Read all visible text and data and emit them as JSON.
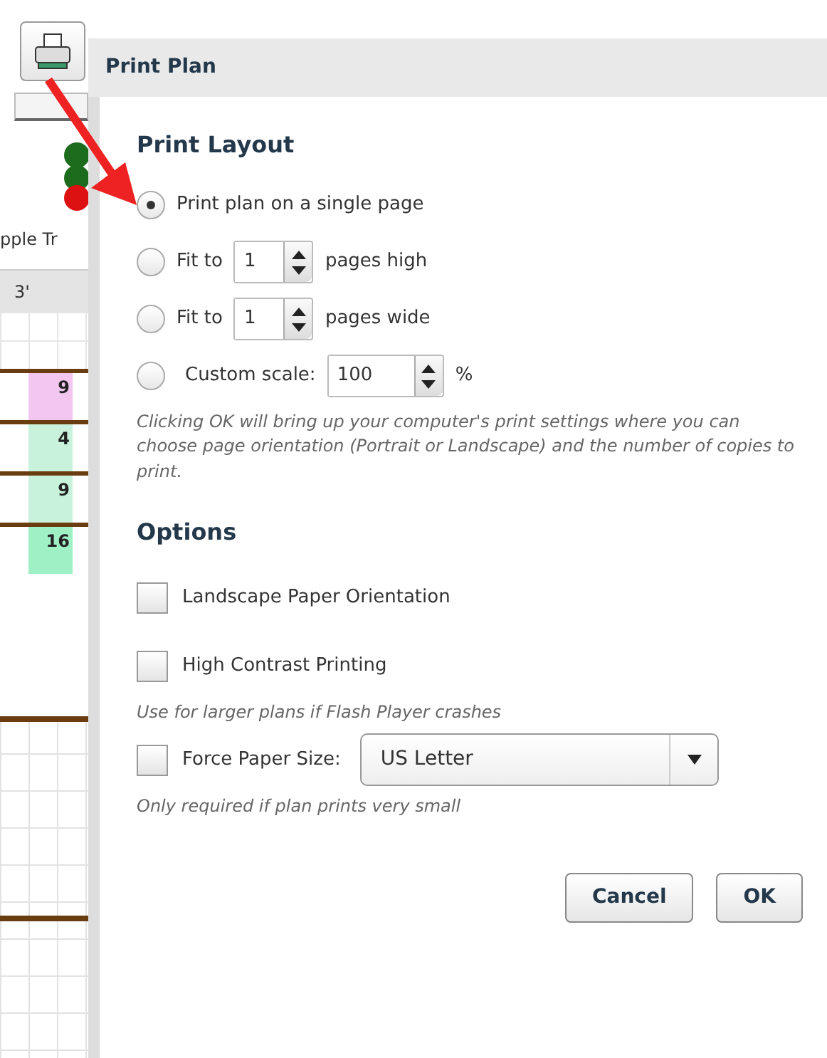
{
  "background": {
    "plant_label": "pple Tr",
    "ruler_mark": "3'",
    "tiles": [
      {
        "count": "9",
        "color": "#f2c6ee"
      },
      {
        "count": "4",
        "color": "#c9f2dc"
      },
      {
        "count": "9",
        "color": "#c9f2dc"
      },
      {
        "count": "16",
        "color": "#9ff0c4"
      }
    ]
  },
  "dialog": {
    "title": "Print Plan",
    "layout_heading": "Print Layout",
    "layout_options": [
      {
        "kind": "plain",
        "label": "Print plan on a single page",
        "selected": true
      },
      {
        "kind": "spinner",
        "label": "Fit to",
        "value": "1",
        "suffix": "pages high",
        "selected": false
      },
      {
        "kind": "spinner",
        "label": "Fit to",
        "value": "1",
        "suffix": "pages wide",
        "selected": false
      },
      {
        "kind": "spinner",
        "label": "Custom scale:",
        "value": "100",
        "suffix": "%",
        "selected": false
      }
    ],
    "layout_note": "Clicking OK will bring up your computer's print settings where you can choose page orientation (Portrait or Landscape) and the number of copies to print.",
    "options_heading": "Options",
    "options": [
      {
        "kind": "plain",
        "label": "Landscape Paper Orientation",
        "checked": false
      },
      {
        "kind": "plain",
        "label": "High Contrast Printing",
        "checked": false,
        "note": "Use for larger plans if Flash Player crashes"
      },
      {
        "kind": "select",
        "label": "Force Paper Size:",
        "value": "US Letter",
        "checked": false,
        "note": "Only required if plan prints very small"
      }
    ],
    "buttons": [
      "Cancel",
      "OK"
    ]
  }
}
